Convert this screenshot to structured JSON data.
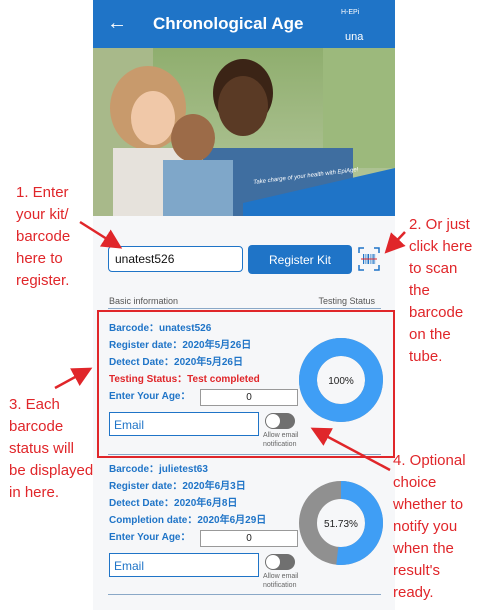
{
  "app": {
    "title": "Chronological Age",
    "logo_text": "H-EPi",
    "user": "una"
  },
  "hero": {
    "tagline": "Take charge of your health with EpiAge!"
  },
  "register": {
    "kit_value": "unatest526",
    "button_label": "Register Kit"
  },
  "section": {
    "left": "Basic information",
    "right": "Testing Status"
  },
  "records": [
    {
      "barcode_label": "Barcode：",
      "barcode": "unatest526",
      "register_label": "Register date：",
      "register_date": "2020年5月26日",
      "detect_label": "Detect Date：",
      "detect_date": "2020年5月26日",
      "status_label": "Testing Status：",
      "status": "Test completed",
      "age_label": "Enter Your Age：",
      "age": "0",
      "email_placeholder": "Email",
      "notify_line1": "Allow email",
      "notify_line2": "notification",
      "progress_label": "100%",
      "progress": 1.0
    },
    {
      "barcode_label": "Barcode：",
      "barcode": "julietest63",
      "register_label": "Register date：",
      "register_date": "2020年6月3日",
      "detect_label": "Detect Date：",
      "detect_date": "2020年6月8日",
      "completion_label": "Completion date：",
      "completion_date": "2020年6月29日",
      "age_label": "Enter Your Age：",
      "age": "0",
      "email_placeholder": "Email",
      "notify_line1": "Allow email",
      "notify_line2": "notification",
      "progress_label": "51.73%",
      "progress": 0.5173
    }
  ],
  "annotations": {
    "a1": [
      "1. Enter",
      "your kit/",
      "barcode",
      "here to",
      "register."
    ],
    "a2": [
      "2. Or just",
      "click here",
      "to scan",
      "the",
      "barcode",
      "on the",
      "tube."
    ],
    "a3": [
      "3. Each",
      "barcode",
      "status will",
      "be displayed",
      "in here."
    ],
    "a4": [
      "4. Optional",
      "choice",
      "whether to",
      "notify you",
      "when the",
      "result's",
      "ready."
    ]
  },
  "colors": {
    "primary": "#1f74c7",
    "annotation_red": "#e0262a",
    "donut_complete": "#3f9ef5",
    "donut_pending": "#909090"
  },
  "icons": {
    "back": "arrow-left-icon",
    "scan": "barcode-scan-icon"
  }
}
